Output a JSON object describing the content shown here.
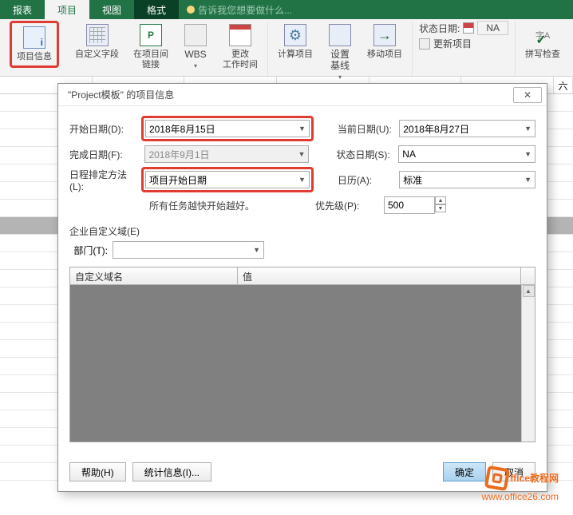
{
  "tabs": {
    "report": "报表",
    "project": "项目",
    "view": "视图",
    "format": "格式",
    "tellme": "告诉我您想要做什么..."
  },
  "ribbon": {
    "project_info": "项目信息",
    "custom_fields": "自定义字段",
    "links": "在项目间\n链接",
    "wbs": "WBS",
    "change_worktime": "更改\n工作时间",
    "calc_project": "计算项目",
    "set_baseline": "设置\n基线",
    "move_project": "移动项目",
    "status_date_label": "状态日期:",
    "status_date_value": "NA",
    "update_project": "更新项目",
    "spell_check": "拼写检查"
  },
  "dialog": {
    "title": "\"Project模板\" 的项目信息",
    "start_date_label": "开始日期(D):",
    "start_date_value": "2018年8月15日",
    "current_date_label": "当前日期(U):",
    "current_date_value": "2018年8月27日",
    "finish_date_label": "完成日期(F):",
    "finish_date_value": "2018年9月1日",
    "status_date_label": "状态日期(S):",
    "status_date_value": "NA",
    "schedule_from_label": "日程排定方法(L):",
    "schedule_from_value": "项目开始日期",
    "calendar_label": "日历(A):",
    "calendar_value": "标准",
    "hint": "所有任务越快开始越好。",
    "priority_label": "优先级(P):",
    "priority_value": "500",
    "enterprise_label": "企业自定义域(E)",
    "dept_label": "部门(T):",
    "grid_col1": "自定义域名",
    "grid_col2": "值",
    "help": "帮助(H)",
    "stats": "统计信息(I)...",
    "ok": "确定",
    "cancel": "取消"
  },
  "sheet": {
    "day_sat": "六"
  },
  "watermark": {
    "brand": "ffice教程网",
    "url": "www.office26.com"
  }
}
